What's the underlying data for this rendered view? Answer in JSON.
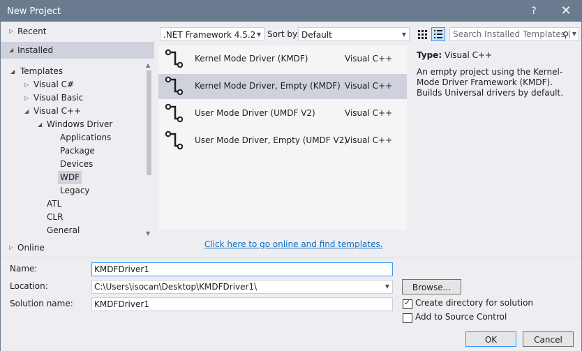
{
  "window": {
    "title": "New Project",
    "help_glyph": "?",
    "close_glyph": "✕"
  },
  "tree": {
    "recent": "Recent",
    "installed": "Installed",
    "online": "Online",
    "nodes": [
      {
        "label": "Templates",
        "expanded": true
      },
      {
        "label": "Visual C#",
        "expanded": false
      },
      {
        "label": "Visual Basic",
        "expanded": false
      },
      {
        "label": "Visual C++",
        "expanded": true
      },
      {
        "label": "Windows Driver",
        "expanded": true
      },
      {
        "label": "Applications"
      },
      {
        "label": "Package"
      },
      {
        "label": "Devices"
      },
      {
        "label": "WDF",
        "selected": true
      },
      {
        "label": "Legacy"
      },
      {
        "label": "ATL"
      },
      {
        "label": "CLR"
      },
      {
        "label": "General"
      }
    ]
  },
  "toolbar": {
    "framework": ".NET Framework 4.5.2",
    "sort_label": "Sort by:",
    "sort_value": "Default",
    "search_placeholder": "Search Installed Templates (",
    "active_view": "list"
  },
  "templates": [
    {
      "name": "Kernel Mode Driver (KMDF)",
      "lang": "Visual C++"
    },
    {
      "name": "Kernel Mode Driver, Empty (KMDF)",
      "lang": "Visual C++",
      "selected": true
    },
    {
      "name": "User Mode Driver (UMDF V2)",
      "lang": "Visual C++"
    },
    {
      "name": "User Mode Driver, Empty (UMDF V2)",
      "lang": "Visual C++"
    }
  ],
  "online_link": "Click here to go online and find templates.",
  "info": {
    "type_label": "Type:",
    "type_value": "Visual C++",
    "description": "An empty project using the Kernel-Mode Driver Framework (KMDF). Builds Universal drivers by default."
  },
  "form": {
    "name_label": "Name:",
    "name_value": "KMDFDriver1",
    "location_label": "Location:",
    "location_value": "C:\\Users\\isocan\\Desktop\\KMDFDriver1\\",
    "solution_label": "Solution name:",
    "solution_value": "KMDFDriver1",
    "browse": "Browse...",
    "create_dir": "Create directory for solution",
    "create_dir_checked": true,
    "source_control": "Add to Source Control",
    "source_control_checked": false,
    "ok": "OK",
    "cancel": "Cancel"
  },
  "colors": {
    "titlebar": "#6b7b8f",
    "selection": "#cfd1dc",
    "link": "#0e70c0"
  }
}
